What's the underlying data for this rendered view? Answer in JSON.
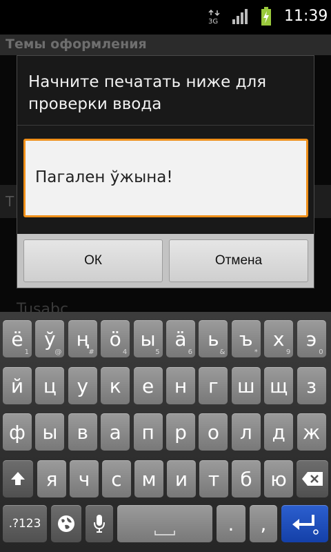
{
  "status_bar": {
    "network": "3G",
    "time": "11:39",
    "icons": [
      "data-3g-icon",
      "signal-icon",
      "battery-charging-icon"
    ]
  },
  "background_app": {
    "title": "Темы оформления",
    "partial_letter": "T",
    "partial_text": "Tusabc"
  },
  "dialog": {
    "message": "Начните печатать ниже для проверки ввода",
    "input_value": "Пагален ўжына!",
    "ok_label": "ОК",
    "cancel_label": "Отмена",
    "accent_color": "#f0901a"
  },
  "keyboard": {
    "rows": [
      [
        {
          "label": "ё",
          "hint": "1"
        },
        {
          "label": "ў",
          "hint": "@"
        },
        {
          "label": "ң",
          "hint": "#"
        },
        {
          "label": "ö",
          "hint": "4"
        },
        {
          "label": "ы",
          "hint": "5"
        },
        {
          "label": "ä",
          "hint": "6"
        },
        {
          "label": "ь",
          "hint": "&"
        },
        {
          "label": "ъ",
          "hint": "*"
        },
        {
          "label": "х",
          "hint": "9"
        },
        {
          "label": "э",
          "hint": "0"
        }
      ],
      [
        {
          "label": "й"
        },
        {
          "label": "ц"
        },
        {
          "label": "у"
        },
        {
          "label": "к"
        },
        {
          "label": "е"
        },
        {
          "label": "н"
        },
        {
          "label": "г"
        },
        {
          "label": "ш"
        },
        {
          "label": "щ"
        },
        {
          "label": "з"
        }
      ],
      [
        {
          "label": "ф"
        },
        {
          "label": "ы"
        },
        {
          "label": "в"
        },
        {
          "label": "а"
        },
        {
          "label": "п"
        },
        {
          "label": "р"
        },
        {
          "label": "о"
        },
        {
          "label": "л"
        },
        {
          "label": "д"
        },
        {
          "label": "ж"
        }
      ],
      [
        {
          "label": "я"
        },
        {
          "label": "ч"
        },
        {
          "label": "с"
        },
        {
          "label": "м"
        },
        {
          "label": "и"
        },
        {
          "label": "т"
        },
        {
          "label": "б"
        },
        {
          "label": "ю"
        }
      ]
    ],
    "symbols_label": ".?123",
    "period_label": ".",
    "comma_label": ",",
    "shift_icon": "shift-arrow-icon",
    "delete_icon": "backspace-icon",
    "language_icon": "globe-icon",
    "mic_icon": "microphone-icon",
    "enter_icon": "enter-arrow-icon"
  }
}
